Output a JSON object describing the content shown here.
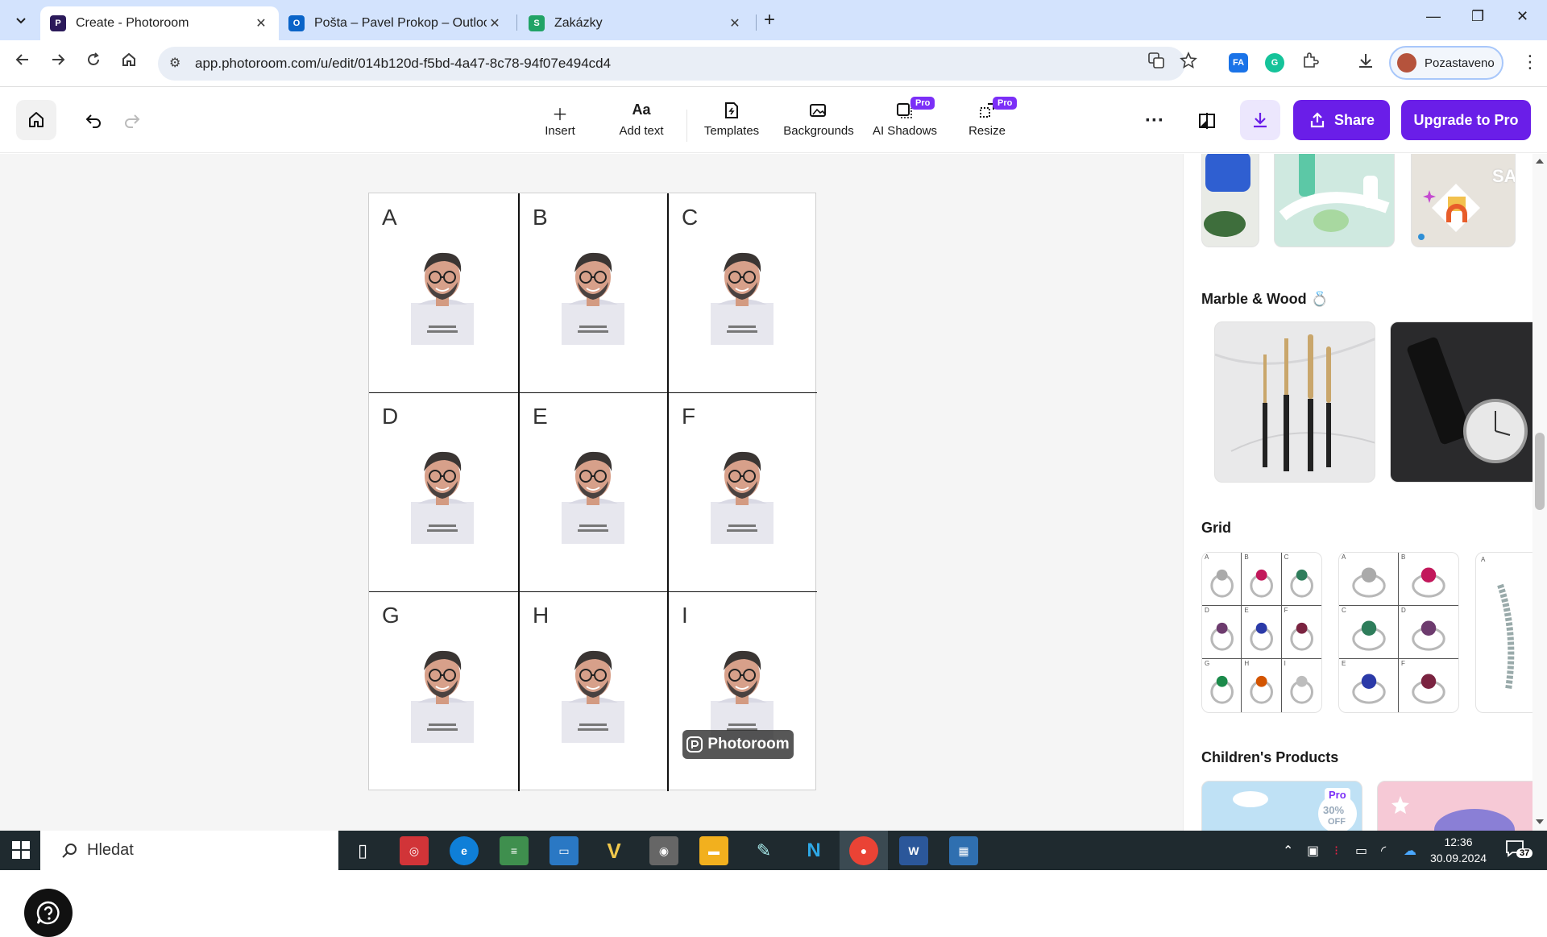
{
  "browser": {
    "tabs": [
      {
        "title": "Create - Photoroom",
        "active": true
      },
      {
        "title": "Pošta – Pavel Prokop – Outlook",
        "active": false
      },
      {
        "title": "Zakázky",
        "active": false
      }
    ],
    "url": "app.photoroom.com/u/edit/014b120d-f5bd-4a47-8c78-94f07e494cd4",
    "profile_label": "Pozastaveno",
    "ext_fa_label": "FA"
  },
  "toolbar": {
    "insert": "Insert",
    "add_text": "Add text",
    "add_text_glyph": "Aa",
    "templates": "Templates",
    "backgrounds": "Backgrounds",
    "ai_shadows": "AI Shadows",
    "resize": "Resize",
    "pro_badge": "Pro",
    "share": "Share",
    "upgrade": "Upgrade to Pro"
  },
  "canvas": {
    "cells": [
      "A",
      "B",
      "C",
      "D",
      "E",
      "F",
      "G",
      "H",
      "I"
    ],
    "watermark": "Photoroom"
  },
  "panel": {
    "sections": [
      {
        "title": "Marble & Wood"
      },
      {
        "title": "Grid"
      },
      {
        "title": "Children's Products"
      }
    ],
    "sale_text": "SALE",
    "pro_badge": "Pro",
    "promo_percent": "30%",
    "promo_off": "OFF",
    "grid_thumb_a_letters": [
      "A",
      "B",
      "C",
      "D",
      "E",
      "F",
      "G",
      "H",
      "I"
    ],
    "grid_thumb_b_letters": [
      "A",
      "B",
      "C",
      "D",
      "E",
      "F"
    ],
    "grid_thumb_c_letter": "A"
  },
  "taskbar": {
    "search_placeholder": "Hledat",
    "time": "12:36",
    "date": "30.09.2024",
    "notifications": "37"
  },
  "colors": {
    "accent": "#6a1ee8",
    "tabbar": "#d3e3fd",
    "taskbar": "#1f2a2f"
  }
}
